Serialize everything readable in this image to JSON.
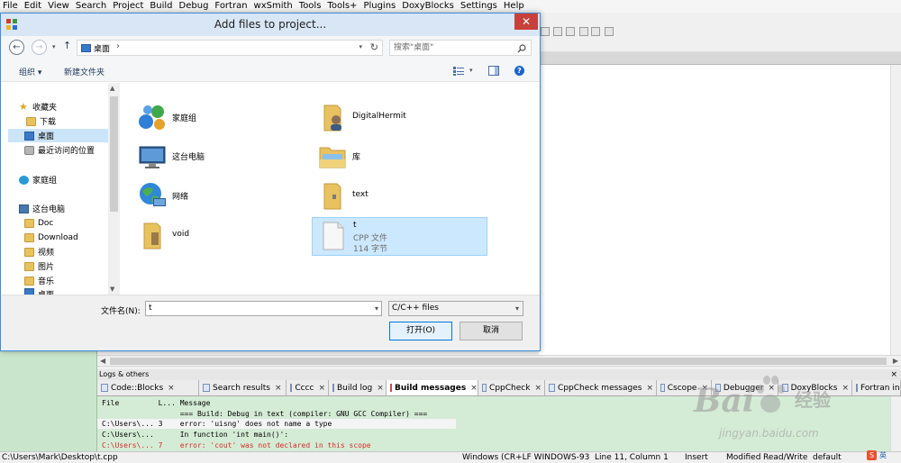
{
  "menu": [
    "File",
    "Edit",
    "View",
    "Search",
    "Project",
    "Build",
    "Debug",
    "Fortran",
    "wxSmith",
    "Tools",
    "Tools+",
    "Plugins",
    "DoxyBlocks",
    "Settings",
    "Help"
  ],
  "dialog": {
    "title": "Add files to project...",
    "close_glyph": "✕",
    "address": {
      "path_item": "桌面",
      "separator": "›"
    },
    "search_placeholder": "搜索\"桌面\"",
    "toolbar": {
      "organize": "组织 ▾",
      "new_folder": "新建文件夹"
    },
    "nav": [
      {
        "label": "收藏夹",
        "icon": "star-icon"
      },
      {
        "label": "下载",
        "icon": "folder-icon"
      },
      {
        "label": "桌面",
        "icon": "desktop-icon",
        "selected": true
      },
      {
        "label": "最近访问的位置",
        "icon": "recent-icon"
      },
      {
        "label": "家庭组",
        "icon": "homegroup-icon"
      },
      {
        "label": "这台电脑",
        "icon": "computer-icon"
      },
      {
        "label": "Doc",
        "icon": "folder-icon"
      },
      {
        "label": "Download",
        "icon": "folder-icon"
      },
      {
        "label": "视频",
        "icon": "folder-icon"
      },
      {
        "label": "图片",
        "icon": "folder-icon"
      },
      {
        "label": "音乐",
        "icon": "folder-icon"
      },
      {
        "label": "桌面",
        "icon": "desktop-icon"
      }
    ],
    "files": [
      {
        "name": "家庭组",
        "icon": "homegroup-icon"
      },
      {
        "name": "DigitalHermit",
        "icon": "user-folder-icon"
      },
      {
        "name": "这台电脑",
        "icon": "computer-icon"
      },
      {
        "name": "库",
        "icon": "library-icon"
      },
      {
        "name": "网络",
        "icon": "network-icon"
      },
      {
        "name": "text",
        "icon": "folder-icon"
      },
      {
        "name": "void",
        "icon": "folder-icon"
      },
      {
        "name": "t",
        "type": "CPP 文件",
        "size": "114 字节",
        "icon": "cpp-file-icon",
        "selected": true
      }
    ],
    "filename_label": "文件名(N):",
    "filename_value": "t",
    "filetype": "C/C++ files",
    "open_button": "打开(O)",
    "cancel_button": "取消"
  },
  "logs": {
    "title": "Logs & others",
    "close": "×",
    "tabs": [
      {
        "label": "Code::Blocks"
      },
      {
        "label": "Search results"
      },
      {
        "label": "Cccc"
      },
      {
        "label": "Build log"
      },
      {
        "label": "Build messages",
        "active": true
      },
      {
        "label": "CppCheck"
      },
      {
        "label": "CppCheck messages"
      },
      {
        "label": "Cscope"
      },
      {
        "label": "Debugger"
      },
      {
        "label": "DoxyBlocks"
      },
      {
        "label": "Fortran in"
      }
    ],
    "rows": [
      "File         L... Message",
      "                  === Build: Debug in text (compiler: GNU GCC Compiler) ===",
      "C:\\Users\\... 3    error: 'uisng' does not name a type",
      "C:\\Users\\...      In function 'int main()':",
      "C:\\Users\\... 7    error: 'cout' was not declared in this scope"
    ]
  },
  "statusbar": {
    "path": "C:\\Users\\Mark\\Desktop\\t.cpp",
    "encoding": "Windows (CR+LF WINDOWS-93(",
    "position": "Line 11, Column 1",
    "mode": "Insert",
    "state": "Modified",
    "access": "Read/Write",
    "profile": "default"
  },
  "watermark": {
    "logo": "Bai",
    "logo2": "经验",
    "url": "jingyan.baidu.com"
  },
  "ime": "英"
}
